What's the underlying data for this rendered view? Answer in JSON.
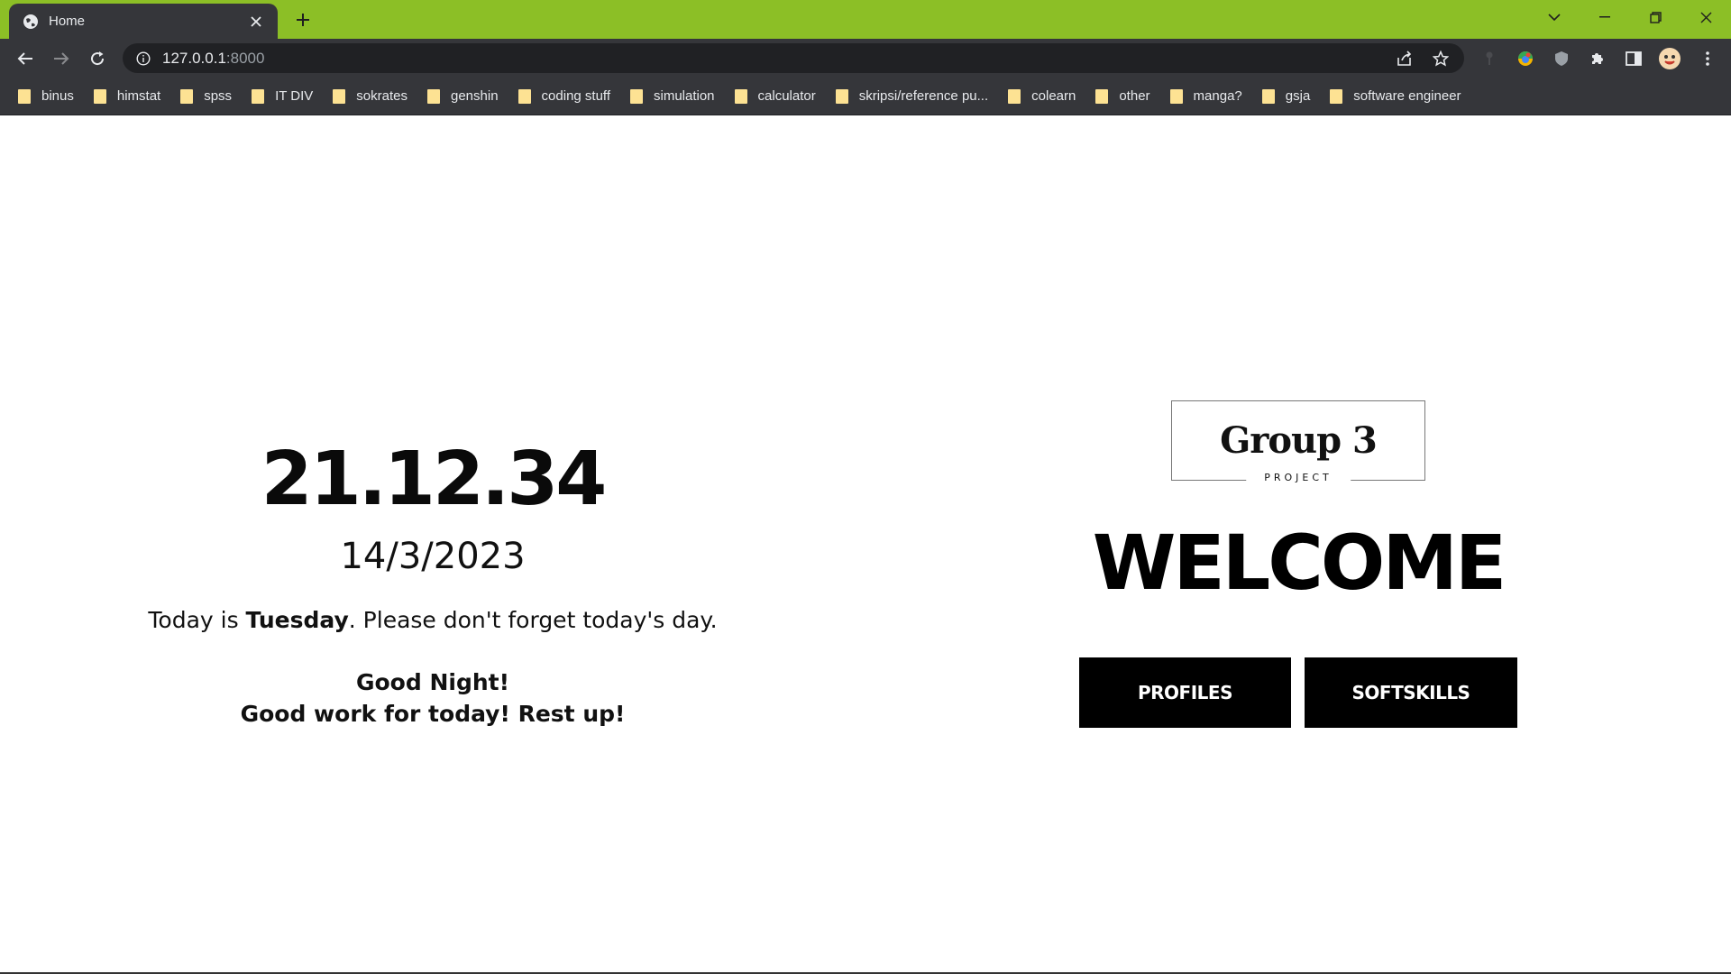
{
  "browser": {
    "tab_title": "Home",
    "url_host": "127.0.0.1",
    "url_port": ":8000",
    "accent_color": "#8cbf26",
    "bookmarks": [
      {
        "label": "binus"
      },
      {
        "label": "himstat"
      },
      {
        "label": "spss"
      },
      {
        "label": "IT DIV"
      },
      {
        "label": "sokrates"
      },
      {
        "label": "genshin"
      },
      {
        "label": "coding stuff"
      },
      {
        "label": "simulation"
      },
      {
        "label": "calculator"
      },
      {
        "label": "skripsi/reference pu..."
      },
      {
        "label": "colearn"
      },
      {
        "label": "other"
      },
      {
        "label": "manga?"
      },
      {
        "label": "gsja"
      },
      {
        "label": "software engineer"
      }
    ]
  },
  "page": {
    "clock": "21.12.34",
    "date": "14/3/2023",
    "day_prefix": "Today is ",
    "day_name": "Tuesday",
    "day_suffix": ". Please don't forget today's day.",
    "greeting_line1": "Good Night!",
    "greeting_line2": "Good work for today! Rest up!",
    "logo_title": "Group 3",
    "logo_subtitle": "PROJECT",
    "welcome": "WELCOME",
    "buttons": {
      "profiles": "PROFILES",
      "softskills": "SOFTSKILLS"
    }
  }
}
